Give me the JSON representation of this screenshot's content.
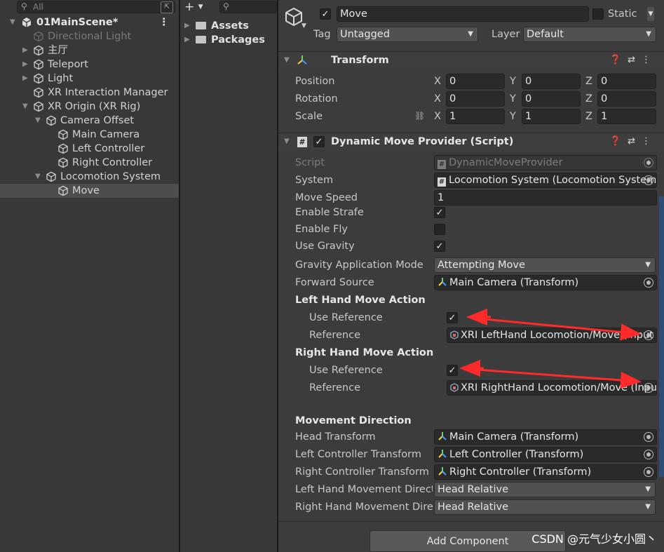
{
  "hierarchy": {
    "search_placeholder": "All",
    "scene_name": "01MainScene*",
    "items": [
      {
        "label": "Directional Light",
        "dimmed": true
      },
      {
        "label": "主厅"
      },
      {
        "label": "Teleport"
      },
      {
        "label": "Light"
      },
      {
        "label": "XR Interaction Manager"
      },
      {
        "label": "XR Origin (XR Rig)"
      },
      {
        "label": "Camera Offset"
      },
      {
        "label": "Main Camera"
      },
      {
        "label": "Left Controller"
      },
      {
        "label": "Right Controller"
      },
      {
        "label": "Locomotion System"
      },
      {
        "label": "Move",
        "selected": true
      }
    ]
  },
  "project": {
    "add_label": "+",
    "folders": [
      "Assets",
      "Packages"
    ]
  },
  "inspector": {
    "object_name": "Move",
    "static_label": "Static",
    "tag_label": "Tag",
    "tag_value": "Untagged",
    "layer_label": "Layer",
    "layer_value": "Default",
    "transform": {
      "title": "Transform",
      "position_label": "Position",
      "rotation_label": "Rotation",
      "scale_label": "Scale",
      "axis_x": "X",
      "axis_y": "Y",
      "axis_z": "Z",
      "position": [
        "0",
        "0",
        "0"
      ],
      "rotation": [
        "0",
        "0",
        "0"
      ],
      "scale": [
        "1",
        "1",
        "1"
      ]
    },
    "provider": {
      "title": "Dynamic Move Provider (Script)",
      "script_label": "Script",
      "script_value": "DynamicMoveProvider",
      "system_label": "System",
      "system_value": "Locomotion System (Locomotion System)",
      "move_speed_label": "Move Speed",
      "move_speed_value": "1",
      "enable_strafe_label": "Enable Strafe",
      "enable_strafe": true,
      "enable_fly_label": "Enable Fly",
      "enable_fly": false,
      "use_gravity_label": "Use Gravity",
      "use_gravity": true,
      "gravity_mode_label": "Gravity Application Mode",
      "gravity_mode_value": "Attempting Move",
      "forward_source_label": "Forward Source",
      "forward_source_value": "Main Camera (Transform)",
      "left_action_header": "Left Hand Move Action",
      "left_use_ref_label": "Use Reference",
      "left_use_ref": true,
      "left_ref_label": "Reference",
      "left_ref_value": "XRI LeftHand Locomotion/Move (Input Action Reference)",
      "right_action_header": "Right Hand Move Action",
      "right_use_ref_label": "Use Reference",
      "right_use_ref": true,
      "right_ref_label": "Reference",
      "right_ref_value": "XRI RightHand Locomotion/Move (Input Action Reference)",
      "movement_dir_header": "Movement Direction",
      "head_transform_label": "Head Transform",
      "head_transform_value": "Main Camera (Transform)",
      "left_ctrl_transform_label": "Left Controller Transform",
      "left_ctrl_transform_value": "Left Controller (Transform)",
      "right_ctrl_transform_label": "Right Controller Transform",
      "right_ctrl_transform_value": "Right Controller (Transform)",
      "left_hand_dir_label": "Left Hand Movement Direction",
      "left_hand_dir_value": "Head Relative",
      "right_hand_dir_label": "Right Hand Movement Direction",
      "right_hand_dir_value": "Head Relative"
    },
    "add_component_label": "Add Component"
  },
  "watermark": "CSDN @元气少女小圆丶",
  "colors": {
    "panel_bg": "#383838",
    "inspector_bg": "#3c3c3c",
    "field_bg": "#2a2a2a",
    "selected_row": "#4d4d4d",
    "annotation_arrow": "#ff2a2a"
  }
}
